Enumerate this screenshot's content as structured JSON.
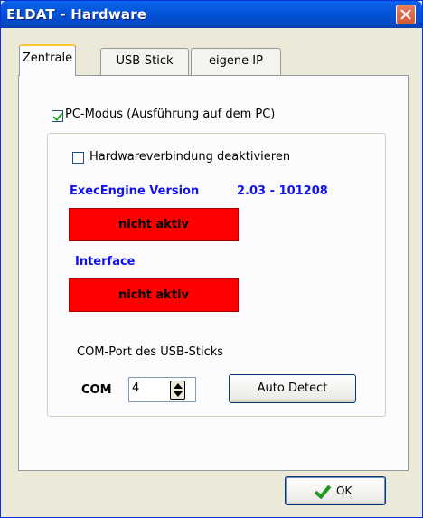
{
  "window": {
    "title": "ELDAT - Hardware"
  },
  "tabs": [
    {
      "label": "Zentrale",
      "active": true
    },
    {
      "label": "USB-Stick",
      "active": false
    },
    {
      "label": "eigene IP",
      "active": false
    }
  ],
  "pc_mode": {
    "label": "PC-Modus (Ausführung auf dem PC)",
    "checked": true
  },
  "hardware_connection": {
    "label": "Hardwareverbindung deaktivieren",
    "checked": false
  },
  "exec_engine": {
    "label": "ExecEngine Version",
    "version": "2.03 - 101208",
    "status": "nicht aktiv"
  },
  "interface": {
    "label": "Interface",
    "status": "nicht aktiv"
  },
  "com_port": {
    "caption": "COM-Port des USB-Sticks",
    "label": "COM",
    "value": "4"
  },
  "buttons": {
    "auto_detect": "Auto Detect",
    "ok": "OK"
  },
  "colors": {
    "status_inactive": "#ff0000",
    "heading_blue": "#1212ef",
    "titlebar": "#0352d6"
  }
}
